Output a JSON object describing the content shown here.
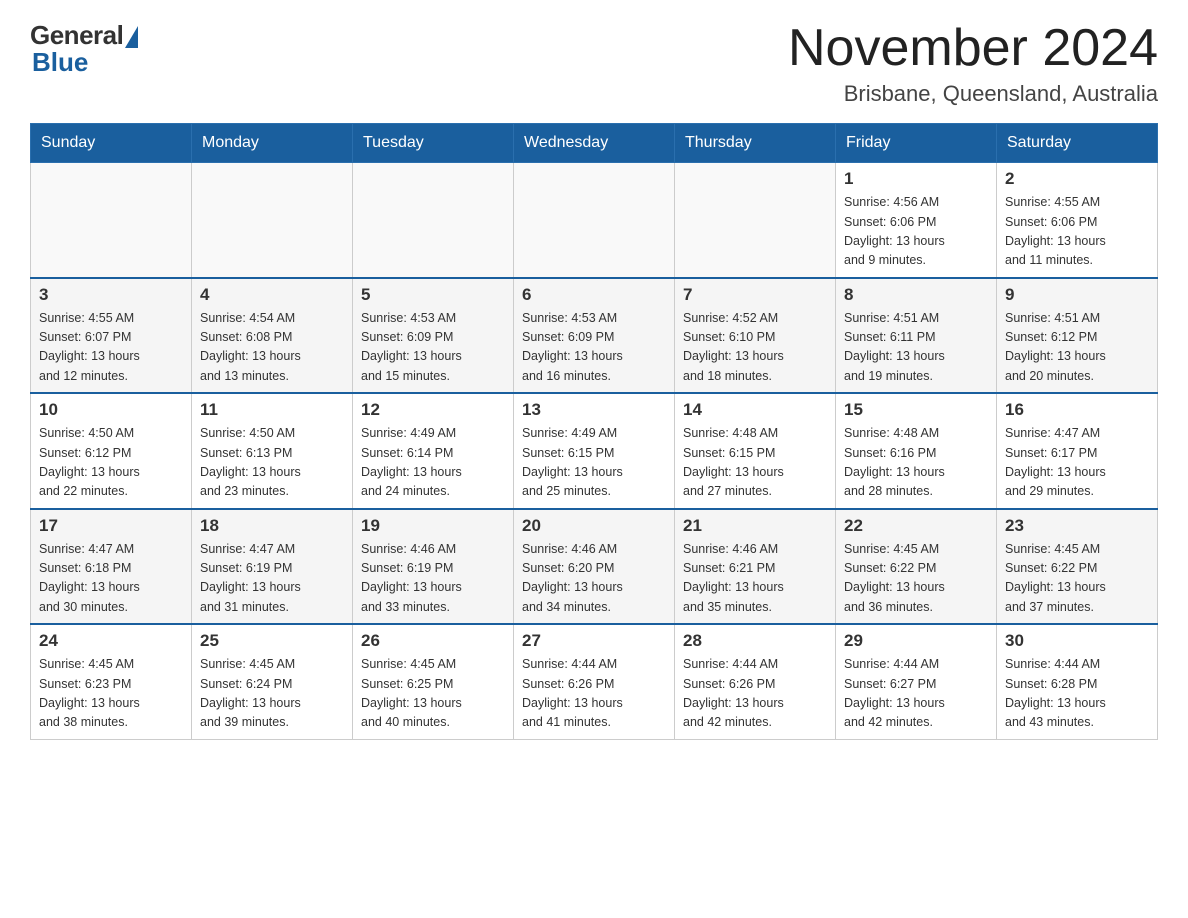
{
  "header": {
    "logo_general": "General",
    "logo_blue": "Blue",
    "month_title": "November 2024",
    "location": "Brisbane, Queensland, Australia"
  },
  "days_of_week": [
    "Sunday",
    "Monday",
    "Tuesday",
    "Wednesday",
    "Thursday",
    "Friday",
    "Saturday"
  ],
  "weeks": [
    {
      "days": [
        {
          "num": "",
          "info": ""
        },
        {
          "num": "",
          "info": ""
        },
        {
          "num": "",
          "info": ""
        },
        {
          "num": "",
          "info": ""
        },
        {
          "num": "",
          "info": ""
        },
        {
          "num": "1",
          "info": "Sunrise: 4:56 AM\nSunset: 6:06 PM\nDaylight: 13 hours\nand 9 minutes."
        },
        {
          "num": "2",
          "info": "Sunrise: 4:55 AM\nSunset: 6:06 PM\nDaylight: 13 hours\nand 11 minutes."
        }
      ]
    },
    {
      "days": [
        {
          "num": "3",
          "info": "Sunrise: 4:55 AM\nSunset: 6:07 PM\nDaylight: 13 hours\nand 12 minutes."
        },
        {
          "num": "4",
          "info": "Sunrise: 4:54 AM\nSunset: 6:08 PM\nDaylight: 13 hours\nand 13 minutes."
        },
        {
          "num": "5",
          "info": "Sunrise: 4:53 AM\nSunset: 6:09 PM\nDaylight: 13 hours\nand 15 minutes."
        },
        {
          "num": "6",
          "info": "Sunrise: 4:53 AM\nSunset: 6:09 PM\nDaylight: 13 hours\nand 16 minutes."
        },
        {
          "num": "7",
          "info": "Sunrise: 4:52 AM\nSunset: 6:10 PM\nDaylight: 13 hours\nand 18 minutes."
        },
        {
          "num": "8",
          "info": "Sunrise: 4:51 AM\nSunset: 6:11 PM\nDaylight: 13 hours\nand 19 minutes."
        },
        {
          "num": "9",
          "info": "Sunrise: 4:51 AM\nSunset: 6:12 PM\nDaylight: 13 hours\nand 20 minutes."
        }
      ]
    },
    {
      "days": [
        {
          "num": "10",
          "info": "Sunrise: 4:50 AM\nSunset: 6:12 PM\nDaylight: 13 hours\nand 22 minutes."
        },
        {
          "num": "11",
          "info": "Sunrise: 4:50 AM\nSunset: 6:13 PM\nDaylight: 13 hours\nand 23 minutes."
        },
        {
          "num": "12",
          "info": "Sunrise: 4:49 AM\nSunset: 6:14 PM\nDaylight: 13 hours\nand 24 minutes."
        },
        {
          "num": "13",
          "info": "Sunrise: 4:49 AM\nSunset: 6:15 PM\nDaylight: 13 hours\nand 25 minutes."
        },
        {
          "num": "14",
          "info": "Sunrise: 4:48 AM\nSunset: 6:15 PM\nDaylight: 13 hours\nand 27 minutes."
        },
        {
          "num": "15",
          "info": "Sunrise: 4:48 AM\nSunset: 6:16 PM\nDaylight: 13 hours\nand 28 minutes."
        },
        {
          "num": "16",
          "info": "Sunrise: 4:47 AM\nSunset: 6:17 PM\nDaylight: 13 hours\nand 29 minutes."
        }
      ]
    },
    {
      "days": [
        {
          "num": "17",
          "info": "Sunrise: 4:47 AM\nSunset: 6:18 PM\nDaylight: 13 hours\nand 30 minutes."
        },
        {
          "num": "18",
          "info": "Sunrise: 4:47 AM\nSunset: 6:19 PM\nDaylight: 13 hours\nand 31 minutes."
        },
        {
          "num": "19",
          "info": "Sunrise: 4:46 AM\nSunset: 6:19 PM\nDaylight: 13 hours\nand 33 minutes."
        },
        {
          "num": "20",
          "info": "Sunrise: 4:46 AM\nSunset: 6:20 PM\nDaylight: 13 hours\nand 34 minutes."
        },
        {
          "num": "21",
          "info": "Sunrise: 4:46 AM\nSunset: 6:21 PM\nDaylight: 13 hours\nand 35 minutes."
        },
        {
          "num": "22",
          "info": "Sunrise: 4:45 AM\nSunset: 6:22 PM\nDaylight: 13 hours\nand 36 minutes."
        },
        {
          "num": "23",
          "info": "Sunrise: 4:45 AM\nSunset: 6:22 PM\nDaylight: 13 hours\nand 37 minutes."
        }
      ]
    },
    {
      "days": [
        {
          "num": "24",
          "info": "Sunrise: 4:45 AM\nSunset: 6:23 PM\nDaylight: 13 hours\nand 38 minutes."
        },
        {
          "num": "25",
          "info": "Sunrise: 4:45 AM\nSunset: 6:24 PM\nDaylight: 13 hours\nand 39 minutes."
        },
        {
          "num": "26",
          "info": "Sunrise: 4:45 AM\nSunset: 6:25 PM\nDaylight: 13 hours\nand 40 minutes."
        },
        {
          "num": "27",
          "info": "Sunrise: 4:44 AM\nSunset: 6:26 PM\nDaylight: 13 hours\nand 41 minutes."
        },
        {
          "num": "28",
          "info": "Sunrise: 4:44 AM\nSunset: 6:26 PM\nDaylight: 13 hours\nand 42 minutes."
        },
        {
          "num": "29",
          "info": "Sunrise: 4:44 AM\nSunset: 6:27 PM\nDaylight: 13 hours\nand 42 minutes."
        },
        {
          "num": "30",
          "info": "Sunrise: 4:44 AM\nSunset: 6:28 PM\nDaylight: 13 hours\nand 43 minutes."
        }
      ]
    }
  ],
  "colors": {
    "header_bg": "#1a5f9e",
    "header_text": "#ffffff",
    "accent_blue": "#1a5f9e"
  }
}
